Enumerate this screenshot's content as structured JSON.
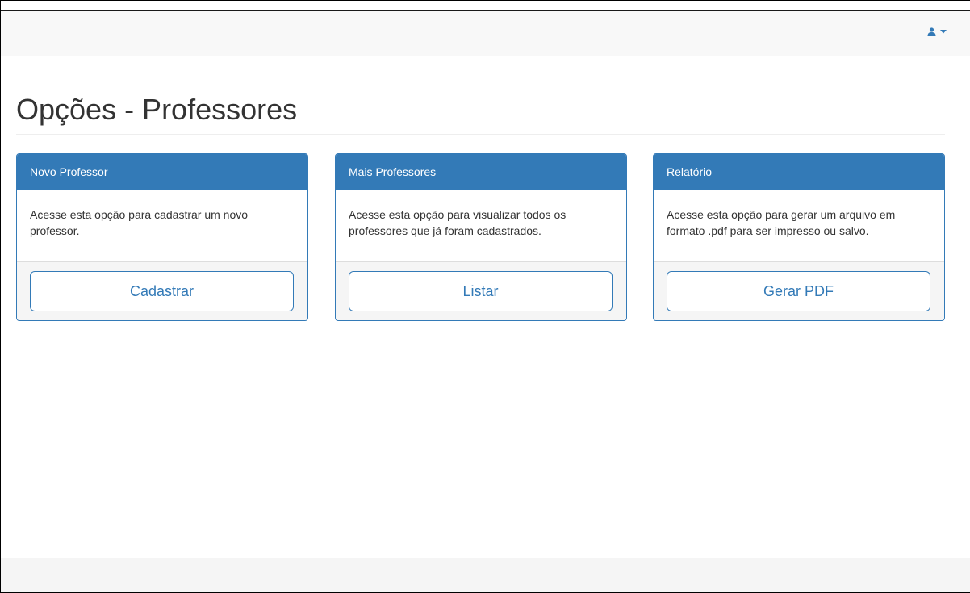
{
  "navbar": {
    "user_icon": "user-icon",
    "caret_icon": "caret-down-icon",
    "accent_color": "#337ab7"
  },
  "page": {
    "title": "Opções - Professores"
  },
  "cards": [
    {
      "header": "Novo Professor",
      "description": "Acesse esta opção para cadastrar um novo professor.",
      "button_label": "Cadastrar"
    },
    {
      "header": "Mais Professores",
      "description": "Acesse esta opção para visualizar todos os professores que já foram cadastrados.",
      "button_label": "Listar"
    },
    {
      "header": "Relatório",
      "description": "Acesse esta opção para gerar um arquivo em formato .pdf para ser impresso ou salvo.",
      "button_label": "Gerar PDF"
    }
  ],
  "colors": {
    "primary": "#337ab7",
    "navbar_bg": "#f8f8f8",
    "footer_bg": "#f5f5f5"
  }
}
